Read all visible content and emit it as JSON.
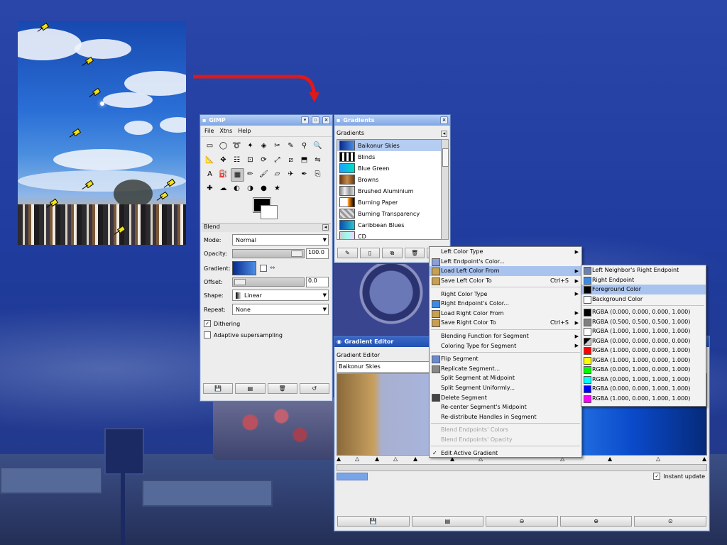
{
  "gimp": {
    "title": "GIMP",
    "menus": [
      "File",
      "Xtns",
      "Help"
    ],
    "blend_section": "Blend",
    "mode_label": "Mode:",
    "mode_value": "Normal",
    "opacity_label": "Opacity:",
    "opacity_value": "100.0",
    "gradient_label": "Gradient:",
    "offset_label": "Offset:",
    "offset_value": "0.0",
    "shape_label": "Shape:",
    "shape_value": "Linear",
    "repeat_label": "Repeat:",
    "repeat_value": "None",
    "dithering_label": "Dithering",
    "dithering_checked": true,
    "adaptive_label": "Adaptive supersampling",
    "adaptive_checked": false
  },
  "gradients": {
    "title": "Gradients",
    "header": "Gradients",
    "items": [
      {
        "name": "Baikonur Skies",
        "colors": "linear-gradient(90deg,#0a2a8c,#4b8fe8)"
      },
      {
        "name": "Blinds",
        "colors": "repeating-linear-gradient(90deg,#000 0 3px,#fff 3px 6px)"
      },
      {
        "name": "Blue Green",
        "colors": "linear-gradient(90deg,#1da0ff,#00e0c0)"
      },
      {
        "name": "Browns",
        "colors": "linear-gradient(90deg,#6b3a12,#c98a4a,#6b3a12)"
      },
      {
        "name": "Brushed Aluminium",
        "colors": "linear-gradient(90deg,#888,#eee,#999,#ddd)"
      },
      {
        "name": "Burning Paper",
        "colors": "linear-gradient(90deg,#fff,#fff 50%,#f80 60%,#000)"
      },
      {
        "name": "Burning Transparency",
        "colors": "repeating-linear-gradient(45deg,#999 0 3px,#ddd 3px 6px)"
      },
      {
        "name": "Caribbean Blues",
        "colors": "linear-gradient(90deg,#0a4fa8,#29c4d4)"
      },
      {
        "name": "CD",
        "colors": "linear-gradient(90deg,#ccc,#9fe,#fcf)"
      }
    ],
    "selected_index": 0
  },
  "gradient_editor": {
    "title": "Gradient Editor",
    "header": "Gradient Editor",
    "name_value": "Baikonur Skies",
    "instant_update_label": "Instant update",
    "instant_update_checked": true
  },
  "context_menu": {
    "items": [
      {
        "label": "Left Color Type",
        "submenu": true
      },
      {
        "label": "Left Endpoint's Color...",
        "icon": "#8aa0d8"
      },
      {
        "label": "Load Left Color From",
        "submenu": true,
        "highlighted": true,
        "icon": "#c8a050"
      },
      {
        "label": "Save Left Color To",
        "accel": "Ctrl+S",
        "submenu": true,
        "icon": "#c8a050"
      },
      {
        "sep": true
      },
      {
        "label": "Right Color Type",
        "submenu": true
      },
      {
        "label": "Right Endpoint's Color...",
        "icon": "#3a8ae8"
      },
      {
        "label": "Load Right Color From",
        "submenu": true,
        "icon": "#c8a050"
      },
      {
        "label": "Save Right Color To",
        "accel": "Ctrl+S",
        "submenu": true,
        "icon": "#c8a050"
      },
      {
        "sep": true
      },
      {
        "label": "Blending Function for Segment",
        "submenu": true
      },
      {
        "label": "Coloring Type for Segment",
        "submenu": true
      },
      {
        "sep": true
      },
      {
        "label": "Flip Segment",
        "icon": "#6a8ad0"
      },
      {
        "label": "Replicate Segment...",
        "icon": "#888"
      },
      {
        "label": "Split Segment at Midpoint"
      },
      {
        "label": "Split Segment Uniformly..."
      },
      {
        "label": "Delete Segment",
        "icon": "#444"
      },
      {
        "label": "Re-center Segment's Midpoint"
      },
      {
        "label": "Re-distribute Handles in Segment"
      },
      {
        "sep": true
      },
      {
        "label": "Blend Endpoints' Colors",
        "disabled": true
      },
      {
        "label": "Blend Endpoints' Opacity",
        "disabled": true
      },
      {
        "sep": true
      },
      {
        "label": "Edit Active Gradient",
        "checked": true
      }
    ]
  },
  "submenu": {
    "items": [
      {
        "label": "Left Neighbor's Right Endpoint",
        "color": "#6f7fb0"
      },
      {
        "label": "Right Endpoint",
        "color": "#3a8ae8"
      },
      {
        "label": "Foreground Color",
        "color": "#000000",
        "highlighted": true
      },
      {
        "label": "Background Color",
        "color": "#ffffff"
      },
      {
        "sep": true
      },
      {
        "label": "RGBA (0.000, 0.000, 0.000, 1.000)",
        "color": "#000000"
      },
      {
        "label": "RGBA (0.500, 0.500, 0.500, 1.000)",
        "color": "#808080"
      },
      {
        "label": "RGBA (1.000, 1.000, 1.000, 1.000)",
        "color": "#ffffff"
      },
      {
        "label": "RGBA (0.000, 0.000, 0.000, 0.000)",
        "color": "linear-gradient(135deg,#000 50%,#ccc 50%)"
      },
      {
        "label": "RGBA (1.000, 0.000, 0.000, 1.000)",
        "color": "#ff0000"
      },
      {
        "label": "RGBA (1.000, 1.000, 0.000, 1.000)",
        "color": "#ffff00"
      },
      {
        "label": "RGBA (0.000, 1.000, 0.000, 1.000)",
        "color": "#00ff00"
      },
      {
        "label": "RGBA (0.000, 1.000, 1.000, 1.000)",
        "color": "#00ffff"
      },
      {
        "label": "RGBA (0.000, 0.000, 1.000, 1.000)",
        "color": "#0000ff"
      },
      {
        "label": "RGBA (1.000, 0.000, 1.000, 1.000)",
        "color": "#ff00ff"
      }
    ]
  },
  "tools": [
    "rect-select-icon",
    "ellipse-select-icon",
    "lasso-icon",
    "fuzzy-select-icon",
    "color-select-icon",
    "scissors-icon",
    "paths-icon",
    "color-picker-icon",
    "zoom-icon",
    "measure-icon",
    "move-icon",
    "align-icon",
    "crop-icon",
    "rotate-icon",
    "scale-icon",
    "shear-icon",
    "perspective-icon",
    "flip-icon",
    "text-icon",
    "bucket-fill-icon",
    "blend-icon",
    "pencil-icon",
    "paintbrush-icon",
    "eraser-icon",
    "airbrush-icon",
    "ink-icon",
    "clone-icon",
    "heal-icon",
    "smudge-icon",
    "convolve-icon",
    "dodge-burn-icon",
    "burn-icon",
    "extra-icon"
  ],
  "colors": {
    "accent": "#3b68c9",
    "title_inactive": "#8fb0e8",
    "selection": "#b6cdf2",
    "menu_highlight": "#a9c3ef"
  }
}
